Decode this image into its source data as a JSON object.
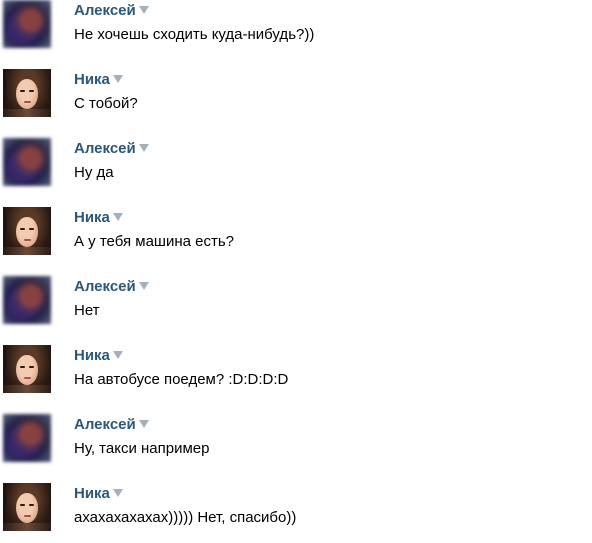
{
  "colors": {
    "author": "#2b587a",
    "text": "#000000",
    "dropdown": "#a4b0bc",
    "background": "#ffffff"
  },
  "messages": [
    {
      "author": "Алексей",
      "avatar": "blurred-avatar",
      "text": "Не хочешь сходить куда-нибудь?))"
    },
    {
      "author": "Ника",
      "avatar": "girl-photo-avatar",
      "text": "С тобой?"
    },
    {
      "author": "Алексей",
      "avatar": "blurred-avatar",
      "text": "Ну да"
    },
    {
      "author": "Ника",
      "avatar": "girl-photo-avatar",
      "text": "А у тебя машина есть?"
    },
    {
      "author": "Алексей",
      "avatar": "blurred-avatar",
      "text": "Нет"
    },
    {
      "author": "Ника",
      "avatar": "girl-photo-avatar",
      "text": "На автобусе поедем? :D:D:D:D"
    },
    {
      "author": "Алексей",
      "avatar": "blurred-avatar",
      "text": "Ну, такси например"
    },
    {
      "author": "Ника",
      "avatar": "girl-photo-avatar",
      "text": "ахахахахахах))))) Нет, спасибо))"
    }
  ]
}
